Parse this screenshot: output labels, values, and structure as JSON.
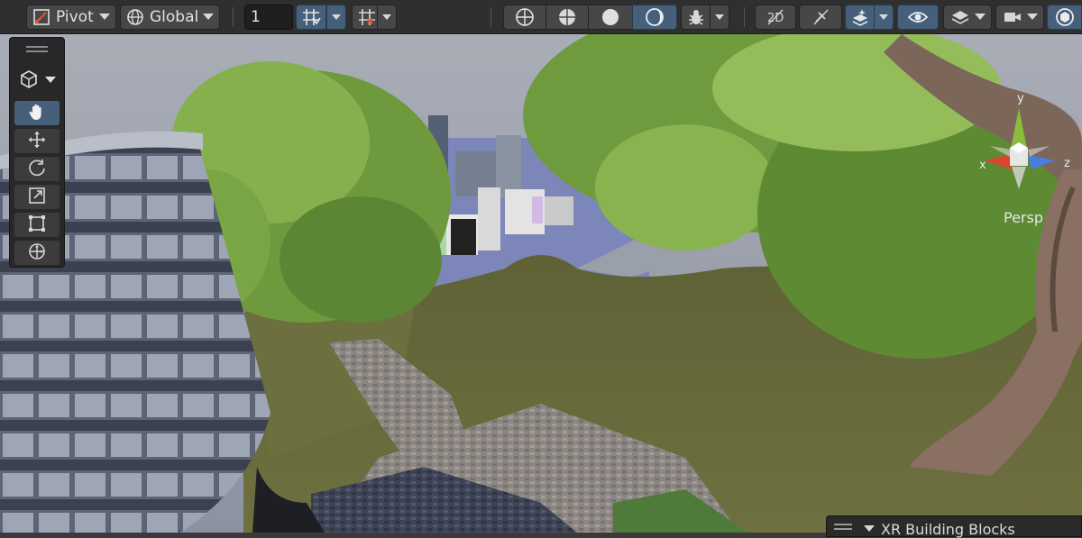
{
  "toolbar": {
    "pivot_label": "Pivot",
    "global_label": "Global",
    "snap_increment": "1",
    "icons": {
      "pivot": "pivot-icon",
      "global": "globe-icon",
      "grid_snap": "grid-snap-icon",
      "increment_snap": "increment-snap-icon",
      "shading_wireframe": "wireframe-sphere-icon",
      "shading_shaded_wire": "shaded-wireframe-sphere-icon",
      "shading_shaded": "shaded-sphere-icon",
      "shading_unlit": "unlit-sphere-icon",
      "debug": "bug-icon",
      "toggle_2d": "2d-toggle-icon",
      "lighting": "light-off-icon",
      "scene_effects": "scene-effects-icon",
      "visibility": "eye-icon",
      "layers": "layers-icon",
      "camera": "camera-icon",
      "gizmos": "gizmos-icon"
    },
    "accent_color": "#46607c"
  },
  "tools_overlay": {
    "view_mode_icon": "cube-icon",
    "tools": [
      {
        "name": "hand-tool",
        "icon": "hand-icon",
        "active": true
      },
      {
        "name": "move-tool",
        "icon": "move-icon",
        "active": false
      },
      {
        "name": "rotate-tool",
        "icon": "rotate-icon",
        "active": false
      },
      {
        "name": "scale-tool",
        "icon": "scale-icon",
        "active": false
      },
      {
        "name": "rect-tool",
        "icon": "rect-transform-icon",
        "active": false
      },
      {
        "name": "transform-tool",
        "icon": "transform-icon",
        "active": false
      }
    ]
  },
  "gizmo": {
    "x_label": "x",
    "y_label": "y",
    "z_label": "z",
    "projection_label": "Persp"
  },
  "xr_panel": {
    "title": "XR Building Blocks"
  }
}
